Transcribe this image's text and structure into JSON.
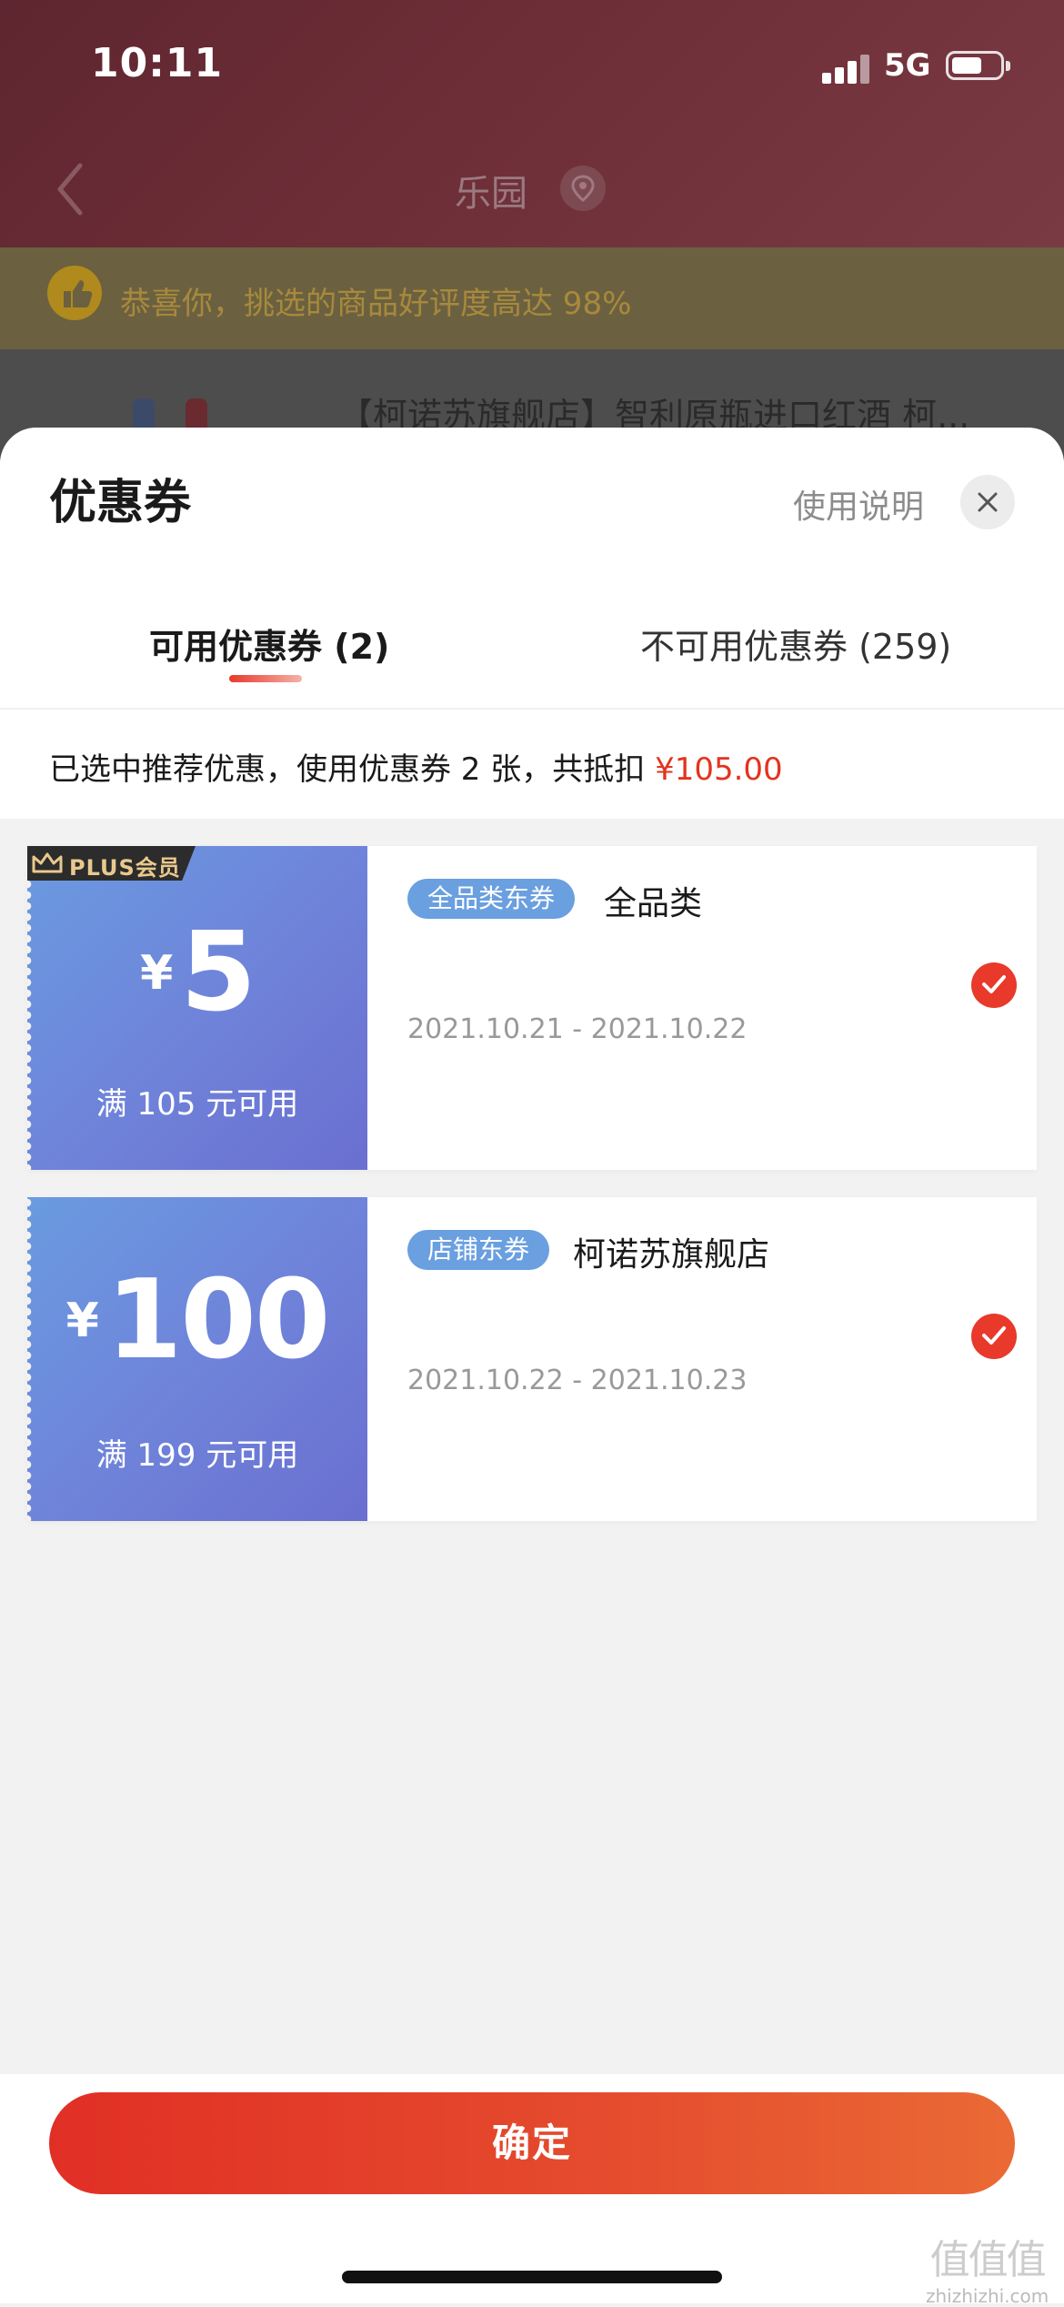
{
  "status_bar": {
    "time": "10:11",
    "network": "5G"
  },
  "background_page": {
    "nav_title": "乐园",
    "banner_text": "恭喜你，挑选的商品好评度高达 98%",
    "product_title": "【柯诺苏旗舰店】智利原瓶进口红酒 柯..."
  },
  "sheet": {
    "title": "优惠券",
    "help_label": "使用说明",
    "tabs": [
      {
        "label": "可用优惠券 (2)",
        "active": true
      },
      {
        "label": "不可用优惠券 (259)",
        "active": false
      }
    ],
    "summary_text": "已选中推荐优惠，使用优惠券 2 张，共抵扣 ",
    "summary_amount": "¥105.00"
  },
  "coupons": [
    {
      "badge": "PLUS会员",
      "currency": "¥",
      "value": "5",
      "threshold": "满 105 元可用",
      "tag": "全品类东券",
      "scope": "全品类",
      "date_range": "2021.10.21 - 2021.10.22",
      "selected": true
    },
    {
      "badge": "",
      "currency": "¥",
      "value": "100",
      "threshold": "满 199 元可用",
      "tag": "店铺东券",
      "scope": "柯诺苏旗舰店",
      "date_range": "2021.10.22 - 2021.10.23",
      "selected": true
    }
  ],
  "footer": {
    "confirm_label": "确定"
  },
  "watermark": {
    "glyphs": "值值值",
    "site": "zhizhizhi.com"
  },
  "colors": {
    "accent_red": "#e8392b",
    "amount_red": "#e2341e",
    "coupon_blue": "#6a9be0",
    "plus_gold": "#e9c98d"
  },
  "icons": [
    "signal-icon",
    "battery-icon",
    "back-chevron-icon",
    "location-icon",
    "thumb-up-icon",
    "close-icon",
    "crown-icon",
    "check-icon"
  ]
}
